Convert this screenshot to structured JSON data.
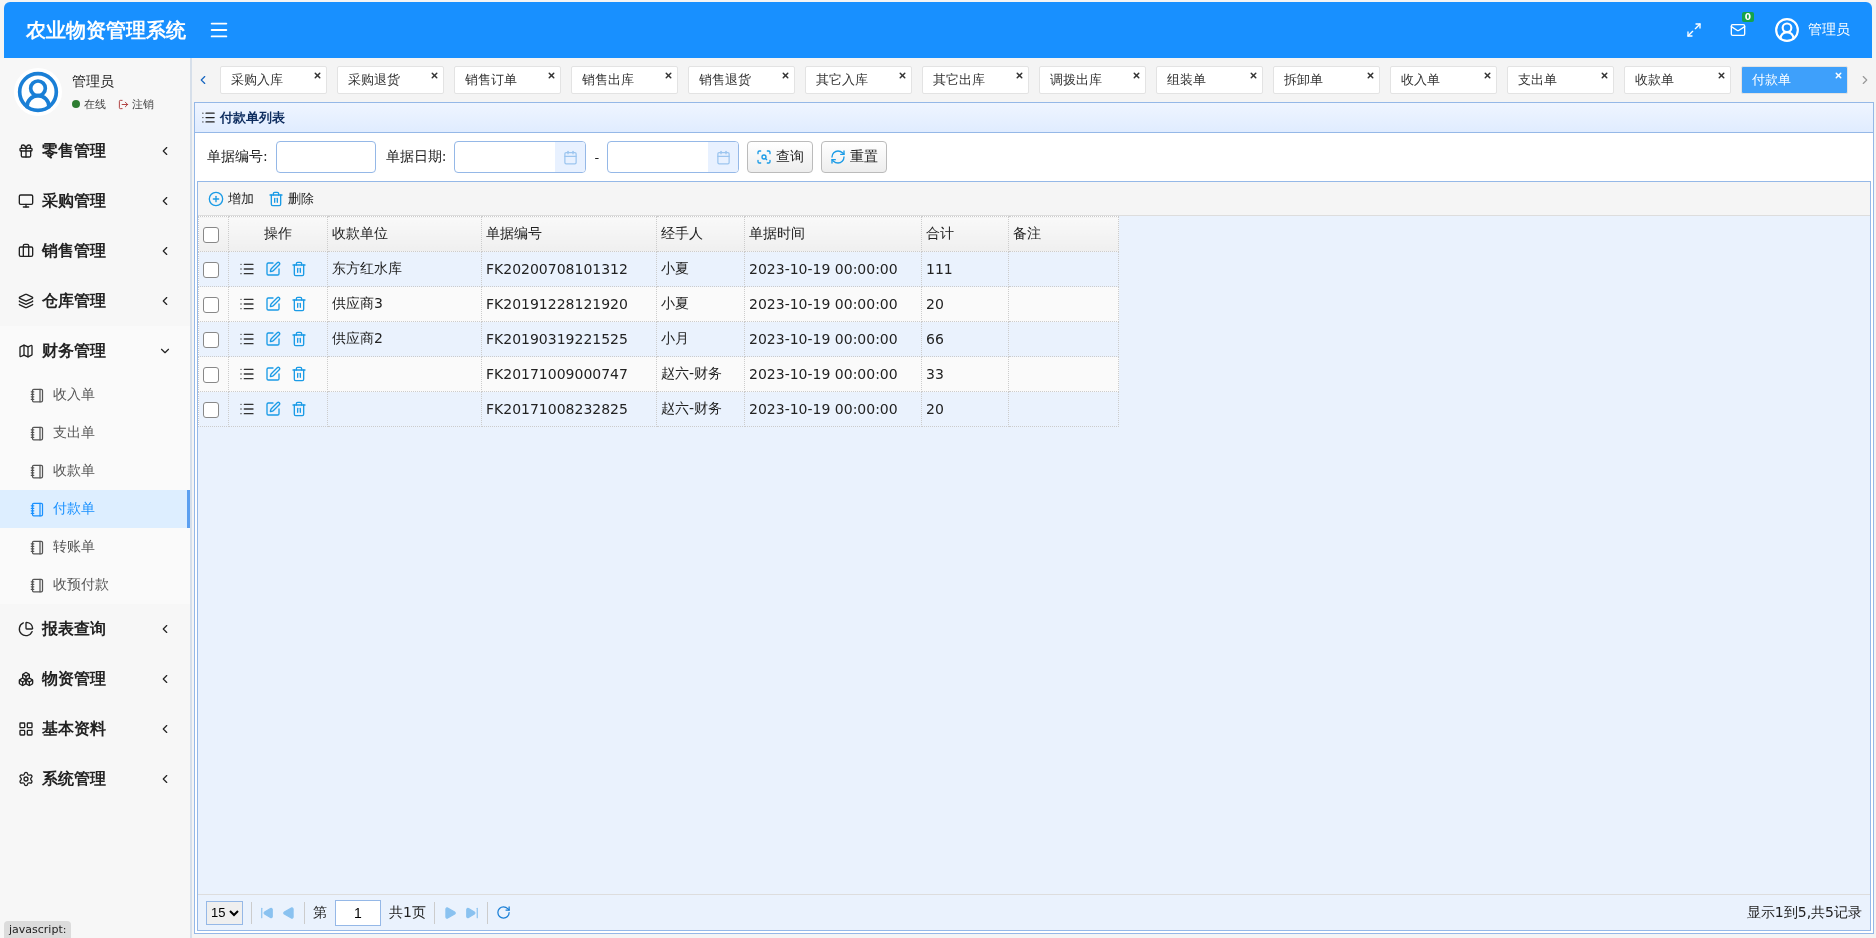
{
  "header": {
    "title": "农业物资管理系统",
    "mail_count": "0",
    "user": "管理员"
  },
  "profile": {
    "name": "管理员",
    "status": "在线",
    "logout": "注销"
  },
  "menu": [
    {
      "label": "零售管理",
      "expanded": false
    },
    {
      "label": "采购管理",
      "expanded": false
    },
    {
      "label": "销售管理",
      "expanded": false
    },
    {
      "label": "仓库管理",
      "expanded": false
    },
    {
      "label": "财务管理",
      "expanded": true,
      "children": [
        {
          "label": "收入单",
          "selected": false
        },
        {
          "label": "支出单",
          "selected": false
        },
        {
          "label": "收款单",
          "selected": false
        },
        {
          "label": "付款单",
          "selected": true
        },
        {
          "label": "转账单",
          "selected": false
        },
        {
          "label": "收预付款",
          "selected": false
        }
      ]
    },
    {
      "label": "报表查询",
      "expanded": false
    },
    {
      "label": "物资管理",
      "expanded": false
    },
    {
      "label": "基本资料",
      "expanded": false
    },
    {
      "label": "系统管理",
      "expanded": false
    }
  ],
  "tabs": [
    {
      "label": "采购入库",
      "selected": false
    },
    {
      "label": "采购退货",
      "selected": false
    },
    {
      "label": "销售订单",
      "selected": false
    },
    {
      "label": "销售出库",
      "selected": false
    },
    {
      "label": "销售退货",
      "selected": false
    },
    {
      "label": "其它入库",
      "selected": false
    },
    {
      "label": "其它出库",
      "selected": false
    },
    {
      "label": "调拨出库",
      "selected": false
    },
    {
      "label": "组装单",
      "selected": false
    },
    {
      "label": "拆卸单",
      "selected": false
    },
    {
      "label": "收入单",
      "selected": false
    },
    {
      "label": "支出单",
      "selected": false
    },
    {
      "label": "收款单",
      "selected": false
    },
    {
      "label": "付款单",
      "selected": true
    }
  ],
  "panel": {
    "title": "付款单列表"
  },
  "search": {
    "code_label": "单据编号:",
    "date_label": "单据日期:",
    "separator": "-",
    "query": "查询",
    "reset": "重置"
  },
  "toolbar": {
    "add": "增加",
    "delete": "删除"
  },
  "table": {
    "header_checked": false,
    "columns": [
      "操作",
      "收款单位",
      "单据编号",
      "经手人",
      "单据时间",
      "合计",
      "备注"
    ],
    "rows": [
      {
        "checked": false,
        "cells": [
          "",
          "东方红水库",
          "FK20200708101312",
          "小夏",
          "2023-10-19 00:00:00",
          "111"
        ]
      },
      {
        "checked": false,
        "cells": [
          "",
          "供应商3",
          "FK20191228121920",
          "小夏",
          "2023-10-19 00:00:00",
          "20"
        ]
      },
      {
        "checked": false,
        "cells": [
          "",
          "供应商2",
          "FK20190319221525",
          "小月",
          "2023-10-19 00:00:00",
          "66"
        ]
      },
      {
        "checked": false,
        "cells": [
          "",
          "",
          "FK20171009000747",
          "赵六-财务",
          "2023-10-19 00:00:00",
          "33"
        ]
      },
      {
        "checked": false,
        "cells": [
          "",
          "",
          "FK20171008232825",
          "赵六-财务",
          "2023-10-19 00:00:00",
          "20"
        ]
      }
    ]
  },
  "pager": {
    "page_size": "15",
    "page_prefix": "第",
    "page": "1",
    "page_suffix": "共1页",
    "summary": "显示1到5,共5记录"
  },
  "status_bar": "javascript:"
}
